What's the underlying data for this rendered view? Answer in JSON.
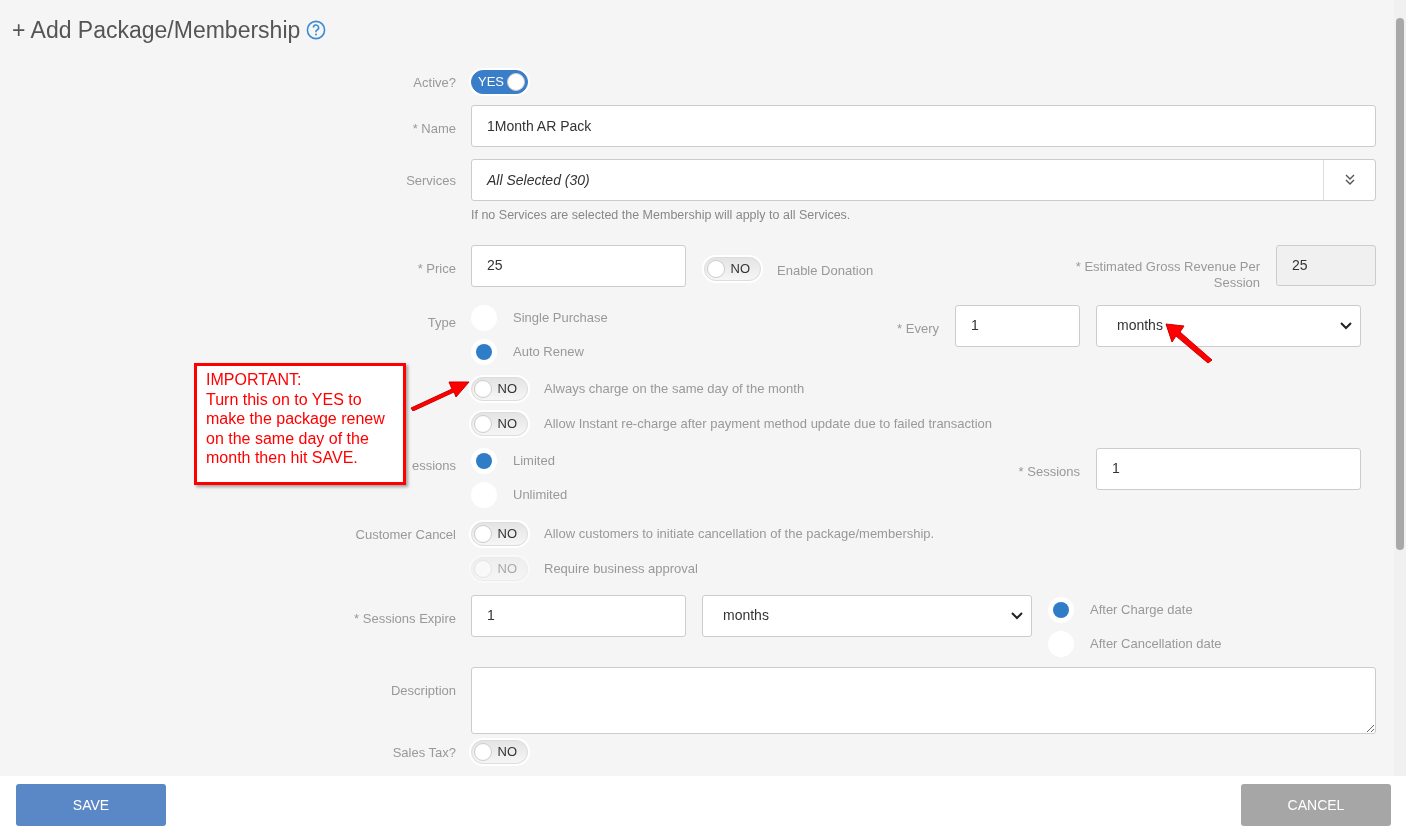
{
  "title": {
    "text": "+ Add Package/Membership"
  },
  "active": {
    "label": "Active?",
    "on": true,
    "text": "YES"
  },
  "name": {
    "label": "* Name",
    "value": "1Month AR Pack"
  },
  "services": {
    "label": "Services",
    "value": "All Selected (30)",
    "help": "If no Services are selected the Membership will apply to all Services."
  },
  "price": {
    "label": "* Price",
    "value": "25",
    "donation": {
      "on": false,
      "text": "NO",
      "label": "Enable Donation"
    }
  },
  "gross_revenue": {
    "label": "* Estimated Gross Revenue Per Session",
    "value": "25"
  },
  "type": {
    "label": "Type",
    "options": [
      {
        "label": "Single Purchase",
        "selected": false
      },
      {
        "label": "Auto Renew",
        "selected": true
      }
    ],
    "every": {
      "label": "* Every",
      "value": "1",
      "unit": "months"
    }
  },
  "renew_toggles": [
    {
      "on": false,
      "text": "NO",
      "label": "Always charge on the same day of the month",
      "disabled": false
    },
    {
      "on": false,
      "text": "NO",
      "label": "Allow Instant re-charge after payment method update due to failed transaction",
      "disabled": false
    }
  ],
  "sessions": {
    "label": "essions",
    "options": [
      {
        "label": "Limited",
        "selected": true
      },
      {
        "label": "Unlimited",
        "selected": false
      }
    ],
    "count": {
      "label": "* Sessions",
      "value": "1"
    }
  },
  "customer_cancel": {
    "label": "Customer Cancel",
    "toggles": [
      {
        "on": false,
        "text": "NO",
        "label": "Allow customers to initiate cancellation of the package/membership.",
        "disabled": false
      },
      {
        "on": false,
        "text": "NO",
        "label": "Require business approval",
        "disabled": true
      }
    ]
  },
  "sessions_expire": {
    "label": "* Sessions Expire",
    "value": "1",
    "unit": "months",
    "options": [
      {
        "label": "After Charge date",
        "selected": true
      },
      {
        "label": "After Cancellation date",
        "selected": false
      }
    ]
  },
  "description": {
    "label": "Description"
  },
  "sales_tax": {
    "label": "Sales Tax?",
    "on": false,
    "text": "NO"
  },
  "annotation": {
    "lines": [
      "IMPORTANT:",
      "Turn this on to YES to",
      "make the package renew",
      "on the same day of the",
      "month then hit SAVE."
    ]
  },
  "footer": {
    "buttons": [
      {
        "label": "SAVE",
        "kind": "primary"
      },
      {
        "label": "CANCEL",
        "kind": "secondary"
      }
    ]
  }
}
